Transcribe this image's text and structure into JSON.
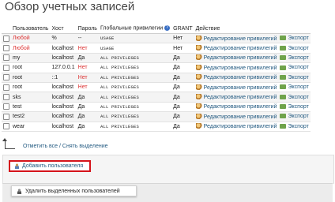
{
  "page": {
    "title": "Обзор учетных записей"
  },
  "table": {
    "headers": {
      "user": "Пользователь",
      "host": "Хост",
      "password": "Пароль",
      "privileges": "Глобальные привилегии",
      "grant": "GRANT",
      "action": "Действие"
    },
    "rows": [
      {
        "user": "Любой",
        "user_red": true,
        "host": "%",
        "password": "--",
        "password_red": false,
        "privileges": "USAGE",
        "grant": "Нет"
      },
      {
        "user": "Любой",
        "user_red": true,
        "host": "localhost",
        "password": "Нет",
        "password_red": true,
        "privileges": "USAGE",
        "grant": "Нет"
      },
      {
        "user": "my",
        "user_red": false,
        "host": "localhost",
        "password": "Да",
        "password_red": false,
        "privileges": "ALL PRIVILEGES",
        "grant": "Да"
      },
      {
        "user": "root",
        "user_red": false,
        "host": "127.0.0.1",
        "password": "Нет",
        "password_red": true,
        "privileges": "ALL PRIVILEGES",
        "grant": "Да"
      },
      {
        "user": "root",
        "user_red": false,
        "host": "::1",
        "password": "Нет",
        "password_red": true,
        "privileges": "ALL PRIVILEGES",
        "grant": "Да"
      },
      {
        "user": "root",
        "user_red": false,
        "host": "localhost",
        "password": "Нет",
        "password_red": true,
        "privileges": "ALL PRIVILEGES",
        "grant": "Да"
      },
      {
        "user": "sks",
        "user_red": false,
        "host": "localhost",
        "password": "Да",
        "password_red": false,
        "privileges": "ALL PRIVILEGES",
        "grant": "Да"
      },
      {
        "user": "test",
        "user_red": false,
        "host": "localhost",
        "password": "Да",
        "password_red": false,
        "privileges": "ALL PRIVILEGES",
        "grant": "Да"
      },
      {
        "user": "test2",
        "user_red": false,
        "host": "localhost",
        "password": "Да",
        "password_red": false,
        "privileges": "ALL PRIVILEGES",
        "grant": "Да"
      },
      {
        "user": "wear",
        "user_red": false,
        "host": "localhost",
        "password": "Да",
        "password_red": false,
        "privileges": "ALL PRIVILEGES",
        "grant": "Да"
      }
    ],
    "edit_label": "Редактирование привилегий",
    "export_label": "Экспорт"
  },
  "check_all_label": "Отметить все / Снять выделение",
  "add_user_label": "Добавить пользователя",
  "delete_users_label": "Удалить выделенных пользователей",
  "colors": {
    "red_text": "#dd3333",
    "link": "#235a81",
    "highlight_border": "#d5141b"
  }
}
